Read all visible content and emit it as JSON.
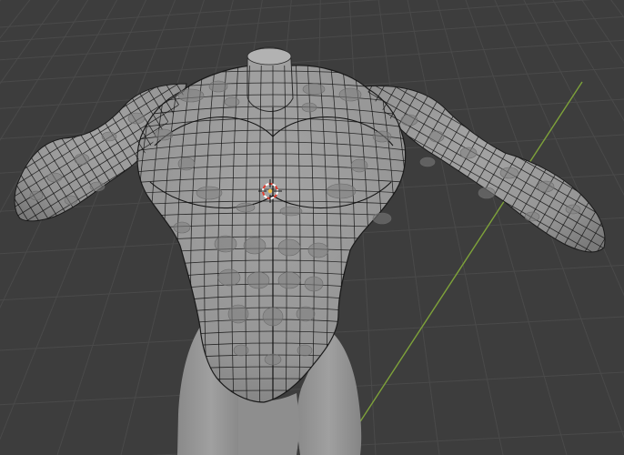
{
  "app": {
    "name": "",
    "window_title": ""
  },
  "viewport": {
    "mode": "edit-mode-wireframe-overlay",
    "background_color": "#3d3d3d",
    "grid_color": "#4a4a4a",
    "y_axis_color": "#7ea23a",
    "mesh_fill_color": "#9c9c9c",
    "mesh_shade_color": "#7f7f7f",
    "wire_color": "#141414",
    "cursor_colors": {
      "ring_a": "#ffffff",
      "ring_b": "#e33b2e",
      "center": "#f5c24a"
    }
  },
  "objects": [
    {
      "name": "",
      "kind": "sculpted-male-torso",
      "shading": "solid",
      "overlay": "wireframe"
    }
  ],
  "icons": {
    "cursor": "3d-cursor-icon"
  }
}
